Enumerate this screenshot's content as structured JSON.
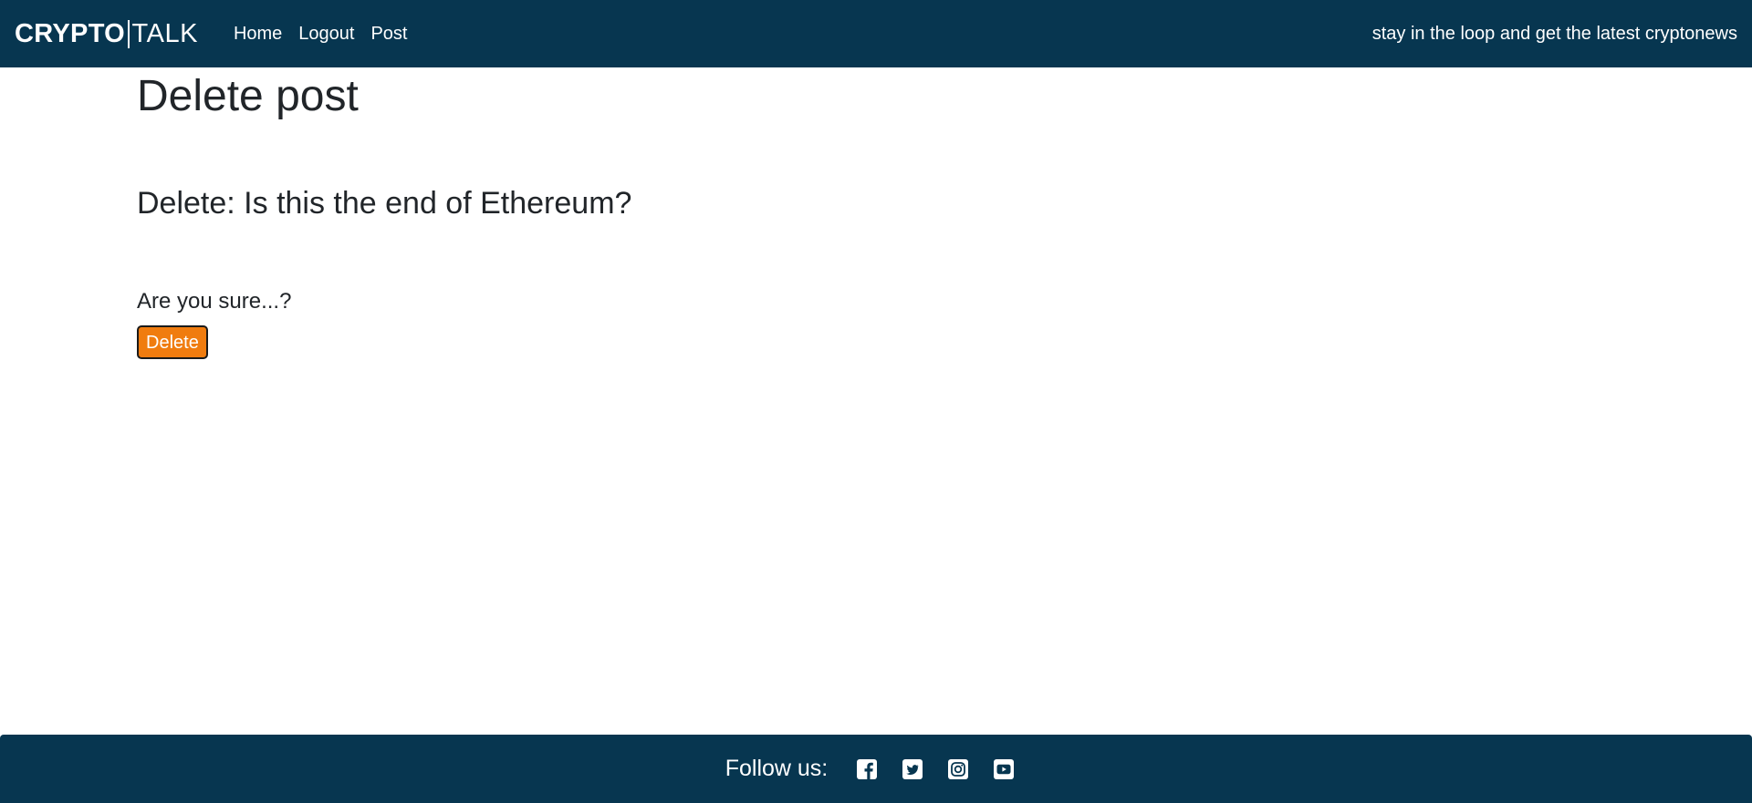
{
  "navbar": {
    "brand_strong": "CRYPTO",
    "brand_light": "TALK",
    "links": [
      {
        "label": "Home"
      },
      {
        "label": "Logout"
      },
      {
        "label": "Post"
      }
    ],
    "tagline": "stay in the loop and get the latest cryptonews"
  },
  "main": {
    "page_title": "Delete post",
    "post_title": "Delete: Is this the end of Ethereum?",
    "confirm_text": "Are you sure...?",
    "delete_label": "Delete"
  },
  "footer": {
    "follow_label": "Follow us:",
    "icons": [
      "facebook-icon",
      "twitter-icon",
      "instagram-icon",
      "youtube-icon"
    ]
  },
  "colors": {
    "navbar_bg": "#073650",
    "footer_bg": "#073650",
    "button_bg": "#f07c0f",
    "text": "#212529"
  }
}
